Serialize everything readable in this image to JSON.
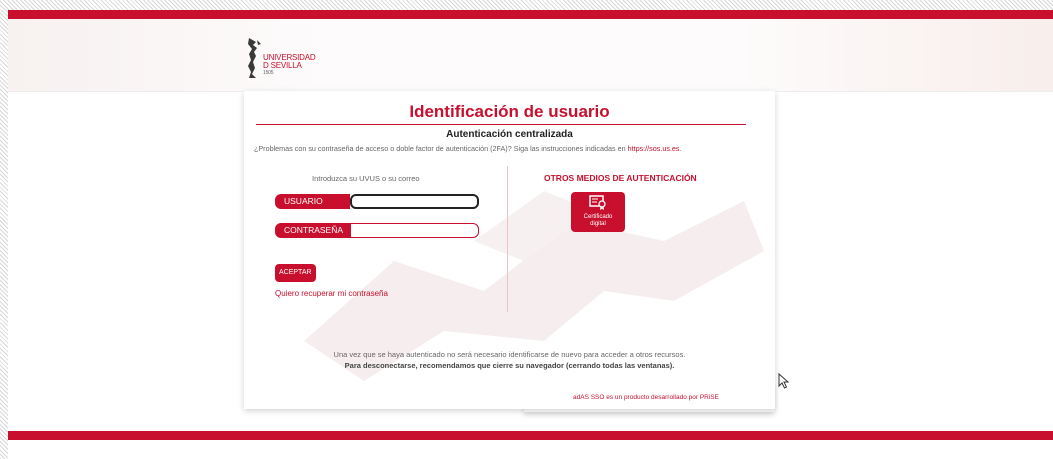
{
  "brand": {
    "logo_lines": [
      "UNIVERSIDAD",
      "D SEVILLA",
      "1505"
    ],
    "accent_color": "#c8102e"
  },
  "login": {
    "title": "Identificación de usuario",
    "subtitle": "Autenticación centralizada",
    "help_text": "¿Problemas con su contraseña de acceso o doble factor de autenticación (2FA)? Siga las instrucciones indicadas en",
    "help_link": "https://sos.us.es",
    "prompt": "Introduzca su UVUS o su correo",
    "user_label": "USUARIO",
    "user_value": "",
    "password_label": "CONTRASEÑA",
    "password_value": "",
    "accept_label": "ACEPTAR",
    "recover_link": "Quiero recuperar mi contraseña"
  },
  "other_methods": {
    "title": "OTROS MEDIOS DE AUTENTICACIÓN",
    "certificate_label_1": "Certificado",
    "certificate_label_2": "digital",
    "certificate_icon": "certificate-icon"
  },
  "footer": {
    "line1": "Una vez que se haya autenticado no será necesario identificarse de nuevo para acceder a otros recursos.",
    "line2": "Para desconectarse, recomendamos que cierre su navegador (cerrando todas las ventanas).",
    "credit": "adAS SSO es un producto desarrollado por PRiSE"
  }
}
